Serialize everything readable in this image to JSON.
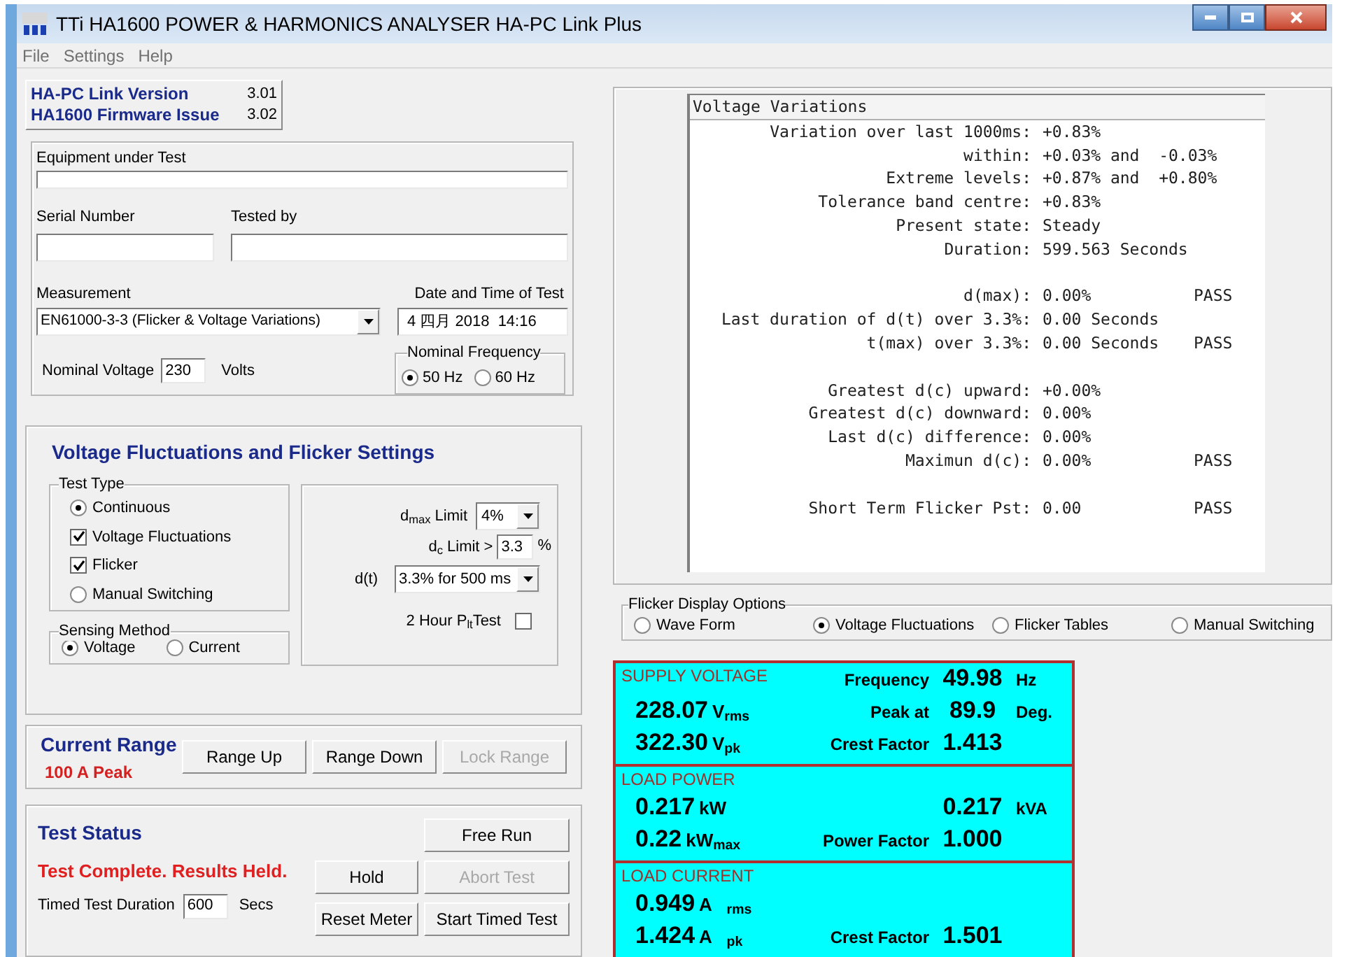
{
  "window": {
    "title": "TTi HA1600 POWER & HARMONICS ANALYSER HA-PC Link Plus"
  },
  "menu": [
    "File",
    "Settings",
    "Help"
  ],
  "version": [
    {
      "label": "HA-PC Link Version",
      "value": "3.01"
    },
    {
      "label": "HA1600 Firmware Issue",
      "value": "3.02"
    }
  ],
  "test_info": {
    "equipment_label": "Equipment under Test",
    "serial_label": "Serial Number",
    "tested_by_label": "Tested by",
    "measurement_label": "Measurement",
    "measurement_value": "EN61000-3-3 (Flicker & Voltage Variations)",
    "date_label": "Date and Time of Test",
    "date_value": "4 四月 2018  14:16",
    "voltage_label": "Nominal Voltage",
    "voltage_value": "230",
    "voltage_unit": "Volts",
    "frequency_label": "Nominal Frequency",
    "frequency_options": [
      {
        "label": "50 Hz",
        "selected": true
      },
      {
        "label": "60 Hz",
        "selected": false
      }
    ]
  },
  "flicker_settings": {
    "title": "Voltage Fluctuations and Flicker Settings",
    "test_type_label": "Test Type",
    "test_type": [
      {
        "kind": "radio",
        "label": "Continuous",
        "checked": true
      },
      {
        "kind": "checkbox",
        "label": "Voltage Fluctuations",
        "checked": true
      },
      {
        "kind": "checkbox",
        "label": "Flicker",
        "checked": true
      },
      {
        "kind": "radio",
        "label": "Manual Switching",
        "checked": false
      }
    ],
    "sensing_label": "Sensing Method",
    "sensing": [
      {
        "label": "Voltage",
        "selected": true
      },
      {
        "label": "Current",
        "selected": false
      }
    ],
    "dmax_label": "d$_{max}$ Limit",
    "dmax_value": "4%",
    "dc_label": "d$_{c}$ Limit >",
    "dc_value": "3.3",
    "dc_unit": "%",
    "dt_label": "d(t)",
    "dt_value": "3.3% for 500 ms",
    "plt_label": "2 Hour P$_{lt}$Test",
    "plt_checked": false
  },
  "current_range": {
    "title": "Current Range",
    "value": "100 A Peak",
    "buttons": [
      {
        "label": "Range Up",
        "disabled": false
      },
      {
        "label": "Range Down",
        "disabled": false
      },
      {
        "label": "Lock Range",
        "disabled": true
      }
    ]
  },
  "test_status": {
    "title": "Test Status",
    "message": "Test Complete. Results Held.",
    "duration_label": "Timed Test Duration",
    "duration_value": "600",
    "duration_unit": "Secs",
    "buttons": [
      {
        "label": "Free Run",
        "disabled": false
      },
      {
        "label": "Hold",
        "disabled": false
      },
      {
        "label": "Abort Test",
        "disabled": true
      },
      {
        "label": "Reset Meter",
        "disabled": false
      },
      {
        "label": "Start Timed Test",
        "disabled": false
      }
    ]
  },
  "voltage_variations": {
    "title": "Voltage Variations",
    "groups": [
      [
        {
          "label": "Variation over last 1000ms:",
          "value": "+0.83%"
        },
        {
          "label": "within:",
          "value": "+0.03% and  -0.03%"
        },
        {
          "label": "Extreme levels:",
          "value": "+0.87% and  +0.80%"
        },
        {
          "label": "Tolerance band centre:",
          "value": "+0.83%"
        },
        {
          "label": "Present state:",
          "value": "Steady"
        },
        {
          "label": "Duration:",
          "value": "599.563 Seconds"
        }
      ],
      [
        {
          "label": "d(max):",
          "value": "0.00%",
          "result": "PASS"
        },
        {
          "label": "Last duration of d(t) over 3.3%:",
          "value": "0.00 Seconds"
        },
        {
          "label": "t(max) over 3.3%:",
          "value": "0.00 Seconds",
          "result": "PASS"
        }
      ],
      [
        {
          "label": "Greatest d(c) upward:",
          "value": "+0.00%"
        },
        {
          "label": "Greatest d(c) downward:",
          "value": "0.00%"
        },
        {
          "label": "Last d(c) difference:",
          "value": "0.00%"
        },
        {
          "label": "Maximun d(c):",
          "value": "0.00%",
          "result": "PASS"
        }
      ],
      [
        {
          "label": "Short Term Flicker Pst:",
          "value": "0.00",
          "result": "PASS"
        }
      ]
    ]
  },
  "flicker_display": {
    "label": "Flicker Display Options",
    "options": [
      {
        "label": "Wave Form",
        "selected": false
      },
      {
        "label": "Voltage Fluctuations",
        "selected": true
      },
      {
        "label": "Flicker Tables",
        "selected": false
      },
      {
        "label": "Manual Switching",
        "selected": false
      }
    ]
  },
  "meter_sections": [
    {
      "title": "SUPPLY VOLTAGE",
      "title_stat": {
        "label": "Frequency",
        "value": "49.98",
        "unit": "Hz"
      },
      "rows": [
        {
          "reading": {
            "value": "228.07",
            "unit": "V$_{rms}$"
          },
          "stat": {
            "label": "Peak at",
            "value": "89.9",
            "unit": "Deg."
          }
        },
        {
          "reading": {
            "value": "322.30",
            "unit": "V$_{pk}$"
          },
          "stat": {
            "label": "Crest Factor",
            "value": "1.413"
          }
        }
      ]
    },
    {
      "title": "LOAD POWER",
      "rows": [
        {
          "reading": {
            "value": "0.217",
            "unit": "kW"
          },
          "stat": {
            "value": "0.217",
            "unit": "kVA"
          }
        },
        {
          "reading": {
            "value": "0.22",
            "unit": "kW$_{max}$"
          },
          "stat": {
            "label": "Power Factor",
            "value": "1.000"
          }
        }
      ]
    },
    {
      "title": "LOAD CURRENT",
      "rows": [
        {
          "reading": {
            "value": "0.949",
            "unit": "A   $_{rms}$"
          }
        },
        {
          "reading": {
            "value": "1.424",
            "unit": "A   $_{pk}$"
          },
          "stat": {
            "label": "Crest Factor",
            "value": "1.501"
          }
        }
      ]
    }
  ]
}
